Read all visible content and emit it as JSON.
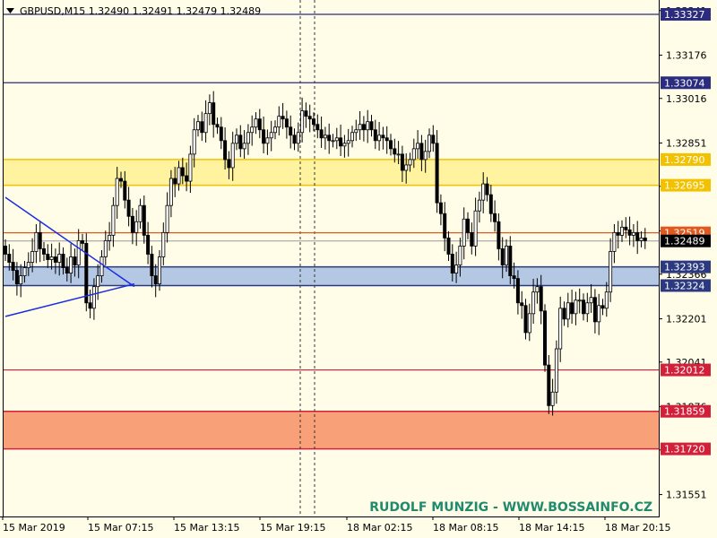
{
  "header": {
    "symbol_info": "GBPUSD,M15  1.32490 1.32491 1.32479 1.32489"
  },
  "watermark": "RUDOLF MUNZIG - WWW.BOSSAINFO.CZ",
  "chart_data": {
    "type": "candlestick",
    "symbol": "GBPUSD",
    "timeframe": "M15",
    "ohlc_current": {
      "open": 1.3249,
      "high": 1.32491,
      "low": 1.32479,
      "close": 1.32489
    },
    "ylim": [
      1.3147,
      1.3338
    ],
    "y_ticks": [
      "1.33341",
      "1.33176",
      "1.33016",
      "1.32851",
      "1.32691",
      "1.32526",
      "1.32366",
      "1.32201",
      "1.32041",
      "1.31876",
      "1.31716",
      "1.31551"
    ],
    "x_ticks": [
      "15 Mar 2019",
      "15 Mar 07:15",
      "15 Mar 13:15",
      "15 Mar 19:15",
      "18 Mar 02:15",
      "18 Mar 08:15",
      "18 Mar 14:15",
      "18 Mar 20:15"
    ],
    "current_price": "1.32489",
    "levels": [
      {
        "price": "1.33327",
        "kind": "resistance",
        "color": "#2b2b80"
      },
      {
        "price": "1.33074",
        "kind": "resistance",
        "color": "#2b2b80"
      },
      {
        "price": "1.32790",
        "kind": "zone-top",
        "color": "#f2c200"
      },
      {
        "price": "1.32695",
        "kind": "zone-bottom",
        "color": "#f2c200"
      },
      {
        "price": "1.32519",
        "kind": "pivot",
        "color": "#e05a20"
      },
      {
        "price": "1.32393",
        "kind": "zone-top",
        "color": "#2b3a80"
      },
      {
        "price": "1.32324",
        "kind": "zone-bottom",
        "color": "#2b3a80"
      },
      {
        "price": "1.32012",
        "kind": "support",
        "color": "#d0203a"
      },
      {
        "price": "1.31859",
        "kind": "zone-top",
        "color": "#d0203a"
      },
      {
        "price": "1.31720",
        "kind": "zone-bottom",
        "color": "#d0203a"
      }
    ],
    "zones": [
      {
        "top": 1.3279,
        "bottom": 1.32695,
        "fill": "#fff3a0",
        "edge": "#f2c200"
      },
      {
        "top": 1.32393,
        "bottom": 1.32324,
        "fill": "#b4c8e4",
        "edge": "#2b3a80"
      },
      {
        "top": 1.31859,
        "bottom": 1.3172,
        "fill": "#f8a078",
        "edge": "#d0203a"
      }
    ],
    "session_separators": [
      "15 Mar 19:15 session",
      "18 Mar 00:00 session"
    ],
    "trendlines": [
      {
        "name": "triangle-upper",
        "from": {
          "bar": 0,
          "price": 1.3265
        },
        "to": {
          "bar": 23,
          "price": 1.3232
        },
        "color": "#1a2ee0"
      },
      {
        "name": "triangle-lower",
        "from": {
          "bar": 0,
          "price": 1.3221
        },
        "to": {
          "bar": 23,
          "price": 1.3233
        },
        "color": "#1a2ee0"
      }
    ],
    "candles_close": [
      1.3244,
      1.3241,
      1.3238,
      1.3233,
      1.3236,
      1.3239,
      1.3241,
      1.3245,
      1.3252,
      1.3246,
      1.3244,
      1.3242,
      1.3243,
      1.3241,
      1.3244,
      1.3239,
      1.3237,
      1.3243,
      1.324,
      1.3249,
      1.3248,
      1.3226,
      1.3224,
      1.3232,
      1.3236,
      1.3243,
      1.3249,
      1.3251,
      1.3262,
      1.3272,
      1.3271,
      1.3264,
      1.3258,
      1.3252,
      1.3256,
      1.3262,
      1.3251,
      1.3244,
      1.3236,
      1.3233,
      1.3243,
      1.3252,
      1.3262,
      1.3272,
      1.327,
      1.3276,
      1.3273,
      1.3271,
      1.3281,
      1.329,
      1.3293,
      1.3289,
      1.3296,
      1.33,
      1.3292,
      1.3291,
      1.3286,
      1.3279,
      1.3276,
      1.3285,
      1.3288,
      1.3283,
      1.3285,
      1.3289,
      1.3291,
      1.3294,
      1.329,
      1.3285,
      1.3287,
      1.3289,
      1.3291,
      1.3295,
      1.3294,
      1.3291,
      1.3288,
      1.3285,
      1.3289,
      1.3297,
      1.3295,
      1.3294,
      1.3292,
      1.329,
      1.3287,
      1.3288,
      1.3286,
      1.3286,
      1.3287,
      1.3284,
      1.3285,
      1.3286,
      1.3289,
      1.329,
      1.3292,
      1.329,
      1.3293,
      1.329,
      1.3286,
      1.3288,
      1.3287,
      1.3286,
      1.3283,
      1.3281,
      1.3281,
      1.3275,
      1.3277,
      1.3279,
      1.3283,
      1.3285,
      1.3279,
      1.3282,
      1.3288,
      1.3285,
      1.3263,
      1.3259,
      1.325,
      1.3244,
      1.3237,
      1.324,
      1.3247,
      1.3257,
      1.3252,
      1.3247,
      1.326,
      1.3264,
      1.327,
      1.3266,
      1.3259,
      1.3256,
      1.3246,
      1.324,
      1.3247,
      1.3236,
      1.3235,
      1.3226,
      1.3225,
      1.3215,
      1.3222,
      1.323,
      1.3232,
      1.3223,
      1.3203,
      1.3188,
      1.3193,
      1.3209,
      1.3224,
      1.322,
      1.3226,
      1.3222,
      1.3227,
      1.3227,
      1.3222,
      1.3226,
      1.3228,
      1.3219,
      1.3225,
      1.3224,
      1.323,
      1.3245,
      1.3252,
      1.3251,
      1.3254,
      1.3253,
      1.3251,
      1.3252,
      1.3249,
      1.325,
      1.3249
    ]
  }
}
